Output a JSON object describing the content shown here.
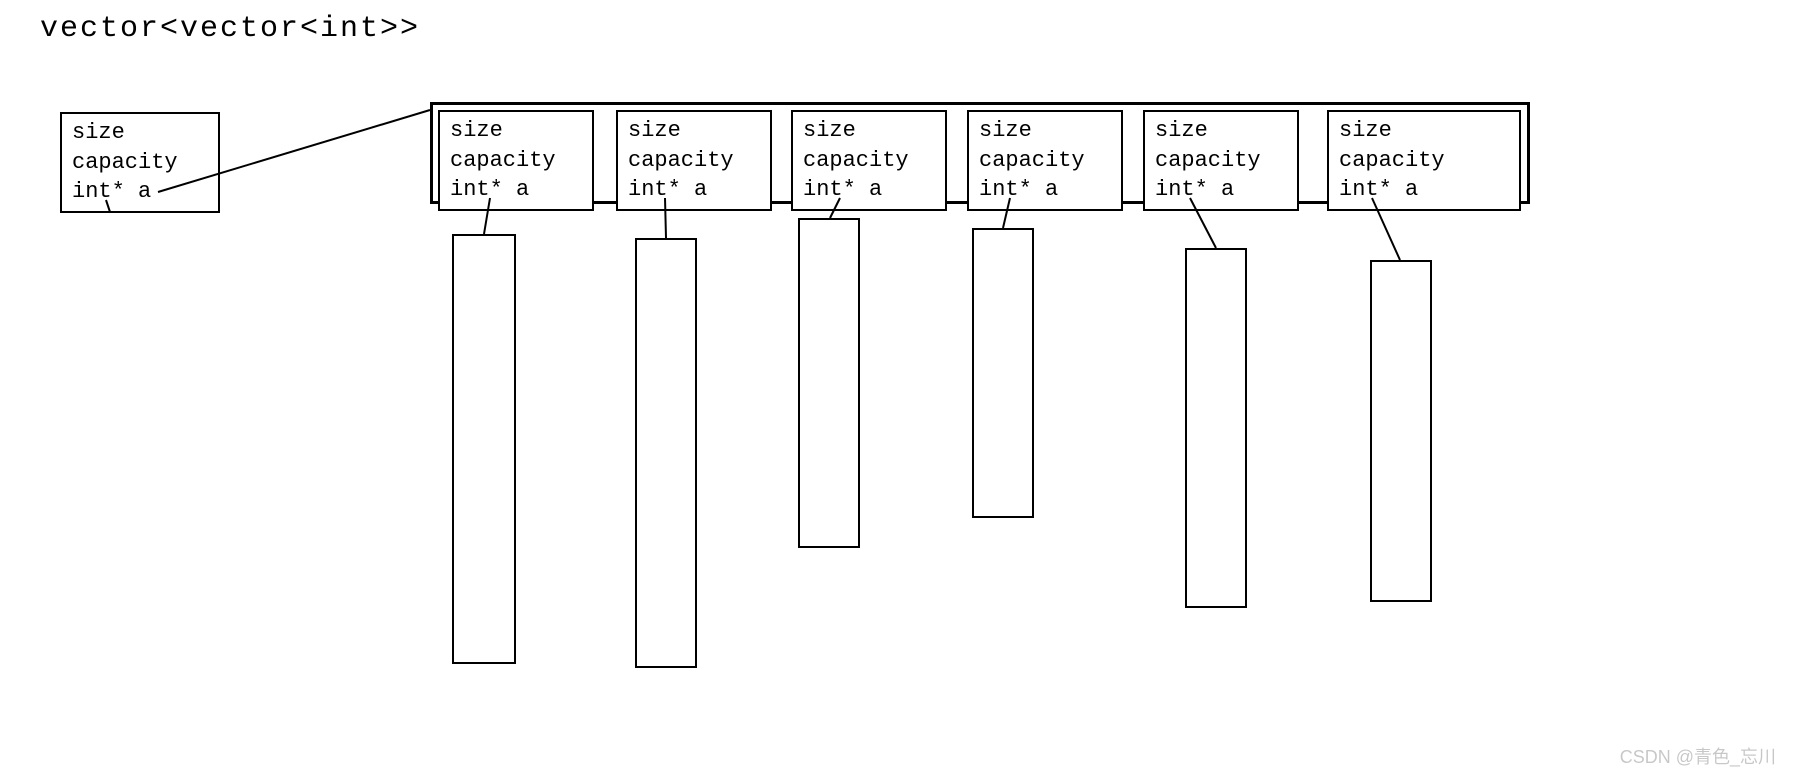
{
  "title": "vector<vector<int>>",
  "outer_struct": {
    "line1": "size",
    "line2": "capacity",
    "line3": "int* a"
  },
  "inner_structs": [
    {
      "line1": "size",
      "line2": "capacity",
      "line3": "int* a"
    },
    {
      "line1": "size",
      "line2": "capacity",
      "line3": "int* a"
    },
    {
      "line1": "size",
      "line2": "capacity",
      "line3": "int* a"
    },
    {
      "line1": "size",
      "line2": "capacity",
      "line3": "int* a"
    },
    {
      "line1": "size",
      "line2": "capacity",
      "line3": "int* a"
    },
    {
      "line1": "size",
      "line2": "capacity",
      "line3": "int* a"
    }
  ],
  "watermark": "CSDN @青色_忘川"
}
